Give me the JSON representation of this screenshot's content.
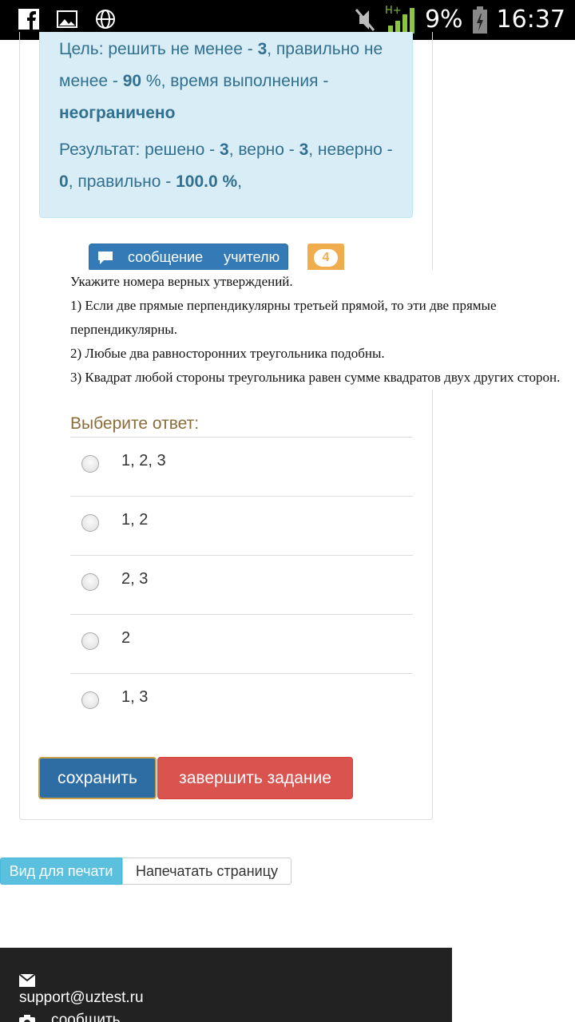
{
  "status_bar": {
    "network": "H+",
    "battery": "9%",
    "time": "16:37",
    "icons": [
      "facebook-icon",
      "gallery-icon",
      "globe-icon",
      "mute-icon",
      "signal-icon",
      "battery-icon"
    ]
  },
  "info": {
    "goal_prefix": "Цель: решить не менее - ",
    "goal_count": "3",
    "goal_mid": ", правильно не менее - ",
    "goal_percent": "90",
    "goal_mid2": " %, время выполнения - ",
    "goal_time": "неограничено",
    "result_prefix": "Результат: решено - ",
    "result_solved": "3",
    "result_mid1": ", верно - ",
    "result_correct": "3",
    "result_mid2": ", неверно - ",
    "result_wrong": "0",
    "result_mid3": ", правильно - ",
    "result_percent": "100.0 %",
    "result_suffix": ","
  },
  "message_button": {
    "word1": "сообщение",
    "word2": "учителю"
  },
  "badge": "4",
  "question": {
    "lines": [
      "Укажите номера верных утверждений.",
      "1) Если две прямые перпендикулярны третьей прямой, то эти две прямые перпендикулярны.",
      "2) Любые два равносторонних треугольника подобны.",
      "3) Квадрат любой стороны треугольника равен сумме квадратов двух других сторон."
    ]
  },
  "choose_label": "Выберите ответ:",
  "answers": [
    "1, 2, 3",
    "1, 2",
    "2, 3",
    "2",
    "1, 3"
  ],
  "buttons": {
    "save": "сохранить",
    "finish": "завершить задание"
  },
  "print": {
    "view": "Вид для печати",
    "page": "Напечатать страницу"
  },
  "footer": {
    "email": "support@uztest.ru",
    "more": "сообщить"
  }
}
